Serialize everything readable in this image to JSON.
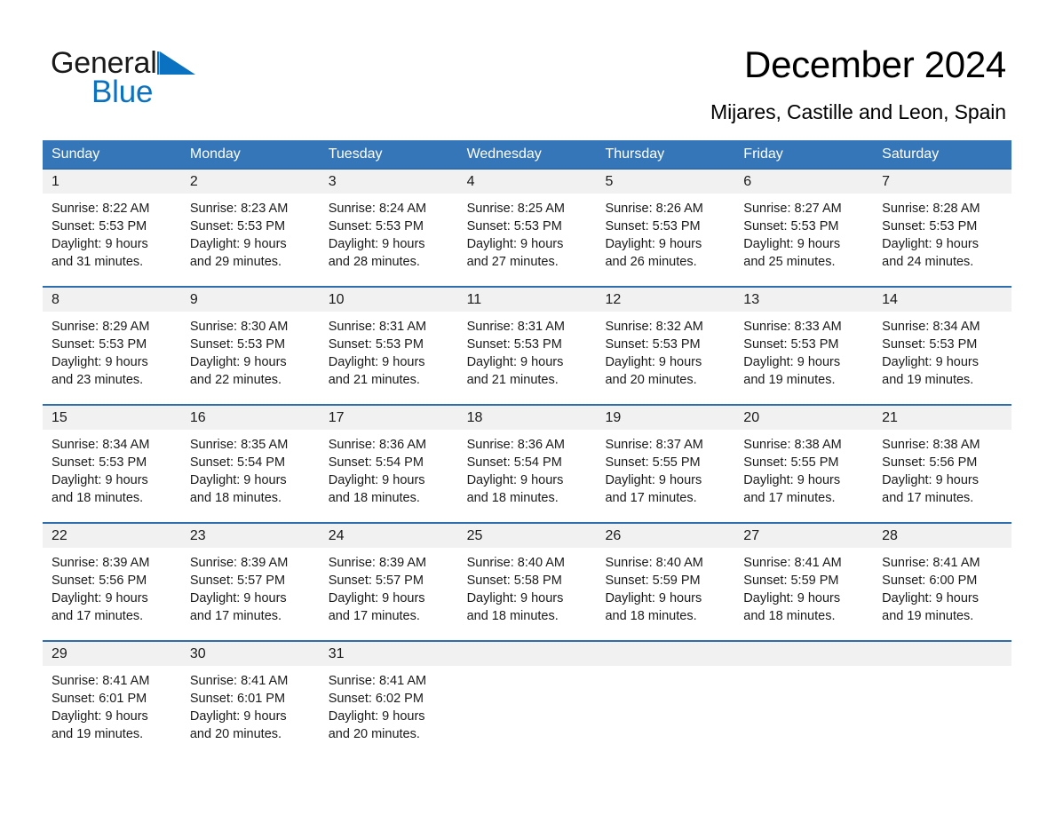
{
  "brand": {
    "word_one": "General",
    "word_two": "Blue",
    "triangle_color": "#0a72c1",
    "blue_text_color": "#0a72c1"
  },
  "header": {
    "title": "December 2024",
    "subtitle": "Mijares, Castille and Leon, Spain"
  },
  "theme": {
    "header_blue": "#3576b8",
    "row_rule_blue": "#2f6dad",
    "day_band_gray": "#f1f1f1"
  },
  "calendar": {
    "weekday_headers": [
      "Sunday",
      "Monday",
      "Tuesday",
      "Wednesday",
      "Thursday",
      "Friday",
      "Saturday"
    ],
    "labels": {
      "sunrise_prefix": "Sunrise:",
      "sunset_prefix": "Sunset:",
      "daylight_prefix": "Daylight:"
    },
    "weeks": [
      [
        {
          "day": "1",
          "sunrise": "Sunrise: 8:22 AM",
          "sunset": "Sunset: 5:53 PM",
          "daylight_line1": "Daylight: 9 hours",
          "daylight_line2": "and 31 minutes."
        },
        {
          "day": "2",
          "sunrise": "Sunrise: 8:23 AM",
          "sunset": "Sunset: 5:53 PM",
          "daylight_line1": "Daylight: 9 hours",
          "daylight_line2": "and 29 minutes."
        },
        {
          "day": "3",
          "sunrise": "Sunrise: 8:24 AM",
          "sunset": "Sunset: 5:53 PM",
          "daylight_line1": "Daylight: 9 hours",
          "daylight_line2": "and 28 minutes."
        },
        {
          "day": "4",
          "sunrise": "Sunrise: 8:25 AM",
          "sunset": "Sunset: 5:53 PM",
          "daylight_line1": "Daylight: 9 hours",
          "daylight_line2": "and 27 minutes."
        },
        {
          "day": "5",
          "sunrise": "Sunrise: 8:26 AM",
          "sunset": "Sunset: 5:53 PM",
          "daylight_line1": "Daylight: 9 hours",
          "daylight_line2": "and 26 minutes."
        },
        {
          "day": "6",
          "sunrise": "Sunrise: 8:27 AM",
          "sunset": "Sunset: 5:53 PM",
          "daylight_line1": "Daylight: 9 hours",
          "daylight_line2": "and 25 minutes."
        },
        {
          "day": "7",
          "sunrise": "Sunrise: 8:28 AM",
          "sunset": "Sunset: 5:53 PM",
          "daylight_line1": "Daylight: 9 hours",
          "daylight_line2": "and 24 minutes."
        }
      ],
      [
        {
          "day": "8",
          "sunrise": "Sunrise: 8:29 AM",
          "sunset": "Sunset: 5:53 PM",
          "daylight_line1": "Daylight: 9 hours",
          "daylight_line2": "and 23 minutes."
        },
        {
          "day": "9",
          "sunrise": "Sunrise: 8:30 AM",
          "sunset": "Sunset: 5:53 PM",
          "daylight_line1": "Daylight: 9 hours",
          "daylight_line2": "and 22 minutes."
        },
        {
          "day": "10",
          "sunrise": "Sunrise: 8:31 AM",
          "sunset": "Sunset: 5:53 PM",
          "daylight_line1": "Daylight: 9 hours",
          "daylight_line2": "and 21 minutes."
        },
        {
          "day": "11",
          "sunrise": "Sunrise: 8:31 AM",
          "sunset": "Sunset: 5:53 PM",
          "daylight_line1": "Daylight: 9 hours",
          "daylight_line2": "and 21 minutes."
        },
        {
          "day": "12",
          "sunrise": "Sunrise: 8:32 AM",
          "sunset": "Sunset: 5:53 PM",
          "daylight_line1": "Daylight: 9 hours",
          "daylight_line2": "and 20 minutes."
        },
        {
          "day": "13",
          "sunrise": "Sunrise: 8:33 AM",
          "sunset": "Sunset: 5:53 PM",
          "daylight_line1": "Daylight: 9 hours",
          "daylight_line2": "and 19 minutes."
        },
        {
          "day": "14",
          "sunrise": "Sunrise: 8:34 AM",
          "sunset": "Sunset: 5:53 PM",
          "daylight_line1": "Daylight: 9 hours",
          "daylight_line2": "and 19 minutes."
        }
      ],
      [
        {
          "day": "15",
          "sunrise": "Sunrise: 8:34 AM",
          "sunset": "Sunset: 5:53 PM",
          "daylight_line1": "Daylight: 9 hours",
          "daylight_line2": "and 18 minutes."
        },
        {
          "day": "16",
          "sunrise": "Sunrise: 8:35 AM",
          "sunset": "Sunset: 5:54 PM",
          "daylight_line1": "Daylight: 9 hours",
          "daylight_line2": "and 18 minutes."
        },
        {
          "day": "17",
          "sunrise": "Sunrise: 8:36 AM",
          "sunset": "Sunset: 5:54 PM",
          "daylight_line1": "Daylight: 9 hours",
          "daylight_line2": "and 18 minutes."
        },
        {
          "day": "18",
          "sunrise": "Sunrise: 8:36 AM",
          "sunset": "Sunset: 5:54 PM",
          "daylight_line1": "Daylight: 9 hours",
          "daylight_line2": "and 18 minutes."
        },
        {
          "day": "19",
          "sunrise": "Sunrise: 8:37 AM",
          "sunset": "Sunset: 5:55 PM",
          "daylight_line1": "Daylight: 9 hours",
          "daylight_line2": "and 17 minutes."
        },
        {
          "day": "20",
          "sunrise": "Sunrise: 8:38 AM",
          "sunset": "Sunset: 5:55 PM",
          "daylight_line1": "Daylight: 9 hours",
          "daylight_line2": "and 17 minutes."
        },
        {
          "day": "21",
          "sunrise": "Sunrise: 8:38 AM",
          "sunset": "Sunset: 5:56 PM",
          "daylight_line1": "Daylight: 9 hours",
          "daylight_line2": "and 17 minutes."
        }
      ],
      [
        {
          "day": "22",
          "sunrise": "Sunrise: 8:39 AM",
          "sunset": "Sunset: 5:56 PM",
          "daylight_line1": "Daylight: 9 hours",
          "daylight_line2": "and 17 minutes."
        },
        {
          "day": "23",
          "sunrise": "Sunrise: 8:39 AM",
          "sunset": "Sunset: 5:57 PM",
          "daylight_line1": "Daylight: 9 hours",
          "daylight_line2": "and 17 minutes."
        },
        {
          "day": "24",
          "sunrise": "Sunrise: 8:39 AM",
          "sunset": "Sunset: 5:57 PM",
          "daylight_line1": "Daylight: 9 hours",
          "daylight_line2": "and 17 minutes."
        },
        {
          "day": "25",
          "sunrise": "Sunrise: 8:40 AM",
          "sunset": "Sunset: 5:58 PM",
          "daylight_line1": "Daylight: 9 hours",
          "daylight_line2": "and 18 minutes."
        },
        {
          "day": "26",
          "sunrise": "Sunrise: 8:40 AM",
          "sunset": "Sunset: 5:59 PM",
          "daylight_line1": "Daylight: 9 hours",
          "daylight_line2": "and 18 minutes."
        },
        {
          "day": "27",
          "sunrise": "Sunrise: 8:41 AM",
          "sunset": "Sunset: 5:59 PM",
          "daylight_line1": "Daylight: 9 hours",
          "daylight_line2": "and 18 minutes."
        },
        {
          "day": "28",
          "sunrise": "Sunrise: 8:41 AM",
          "sunset": "Sunset: 6:00 PM",
          "daylight_line1": "Daylight: 9 hours",
          "daylight_line2": "and 19 minutes."
        }
      ],
      [
        {
          "day": "29",
          "sunrise": "Sunrise: 8:41 AM",
          "sunset": "Sunset: 6:01 PM",
          "daylight_line1": "Daylight: 9 hours",
          "daylight_line2": "and 19 minutes."
        },
        {
          "day": "30",
          "sunrise": "Sunrise: 8:41 AM",
          "sunset": "Sunset: 6:01 PM",
          "daylight_line1": "Daylight: 9 hours",
          "daylight_line2": "and 20 minutes."
        },
        {
          "day": "31",
          "sunrise": "Sunrise: 8:41 AM",
          "sunset": "Sunset: 6:02 PM",
          "daylight_line1": "Daylight: 9 hours",
          "daylight_line2": "and 20 minutes."
        },
        {
          "day": "",
          "sunrise": "",
          "sunset": "",
          "daylight_line1": "",
          "daylight_line2": ""
        },
        {
          "day": "",
          "sunrise": "",
          "sunset": "",
          "daylight_line1": "",
          "daylight_line2": ""
        },
        {
          "day": "",
          "sunrise": "",
          "sunset": "",
          "daylight_line1": "",
          "daylight_line2": ""
        },
        {
          "day": "",
          "sunrise": "",
          "sunset": "",
          "daylight_line1": "",
          "daylight_line2": ""
        }
      ]
    ]
  }
}
